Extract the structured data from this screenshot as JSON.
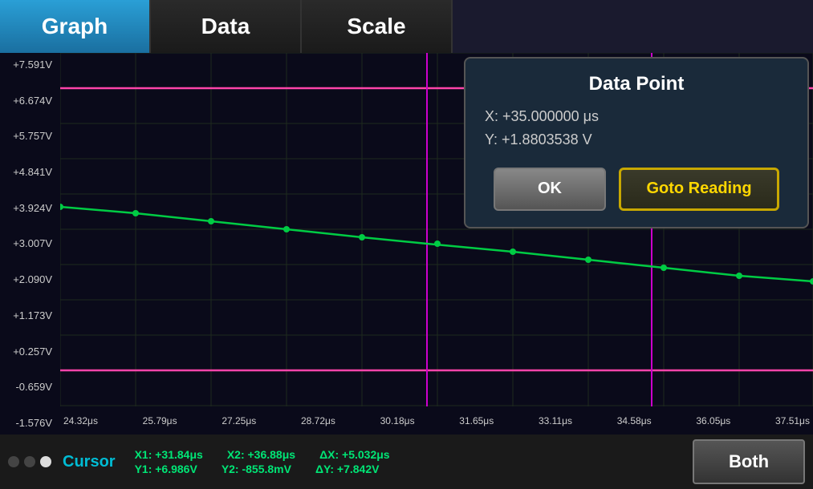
{
  "tabs": [
    {
      "label": "Graph",
      "active": true
    },
    {
      "label": "Data",
      "active": false
    },
    {
      "label": "Scale",
      "active": false
    }
  ],
  "graph": {
    "y_labels": [
      "+7.591V",
      "+6.674V",
      "+5.757V",
      "+4.841V",
      "+3.924V",
      "+3.007V",
      "+2.090V",
      "+1.173V",
      "+0.257V",
      "-0.659V",
      "-1.576V"
    ],
    "x_labels": [
      "24.32μs",
      "25.79μs",
      "27.25μs",
      "28.72μs",
      "30.18μs",
      "31.65μs",
      "33.11μs",
      "34.58μs",
      "36.05μs",
      "37.51μs"
    ],
    "colors": {
      "background": "#0a0a1a",
      "grid": "#1e2a1e",
      "cursor_line": "#cc00cc",
      "trace_green": "#00cc44",
      "trace_magenta_top": "#ff44aa",
      "trace_magenta_bottom": "#ff44aa"
    }
  },
  "popup": {
    "title": "Data Point",
    "x_label": "X:",
    "x_value": "+35.000000 μs",
    "y_label": "Y:",
    "y_value": "+1.8803538 V",
    "ok_label": "OK",
    "goto_label": "Goto Reading"
  },
  "bottom_bar": {
    "cursor_label": "Cursor",
    "stats": {
      "x1": "X1: +31.84μs",
      "x2": "X2: +36.88μs",
      "dx": "ΔX: +5.032μs",
      "y1": "Y1: +6.986V",
      "y2": "Y2: -855.8mV",
      "dy": "ΔY: +7.842V"
    },
    "both_label": "Both"
  }
}
